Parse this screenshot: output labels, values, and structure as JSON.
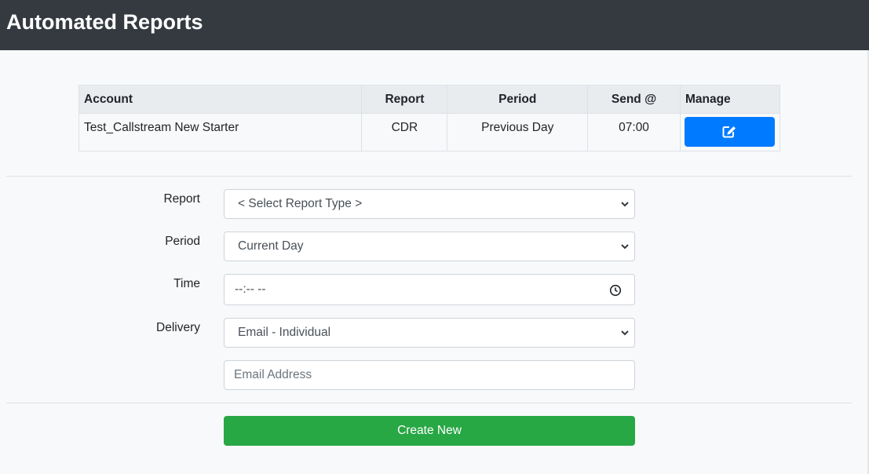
{
  "header": {
    "title": "Automated Reports"
  },
  "table": {
    "columns": {
      "account": "Account",
      "report": "Report",
      "period": "Period",
      "send": "Send @",
      "manage": "Manage"
    },
    "rows": [
      {
        "account": "Test_Callstream New Starter",
        "report": "CDR",
        "period": "Previous Day",
        "send": "07:00",
        "manage_icon": "edit-icon"
      }
    ]
  },
  "form": {
    "report": {
      "label": "Report",
      "selected": "< Select Report Type >"
    },
    "period": {
      "label": "Period",
      "selected": "Current Day"
    },
    "time": {
      "label": "Time",
      "value": "--:-- --"
    },
    "delivery": {
      "label": "Delivery",
      "selected": "Email - Individual"
    },
    "email": {
      "placeholder": "Email Address"
    },
    "submit_label": "Create New"
  },
  "colors": {
    "header_bg": "#343a40",
    "edit_button": "#007bff",
    "create_button": "#28a745"
  }
}
